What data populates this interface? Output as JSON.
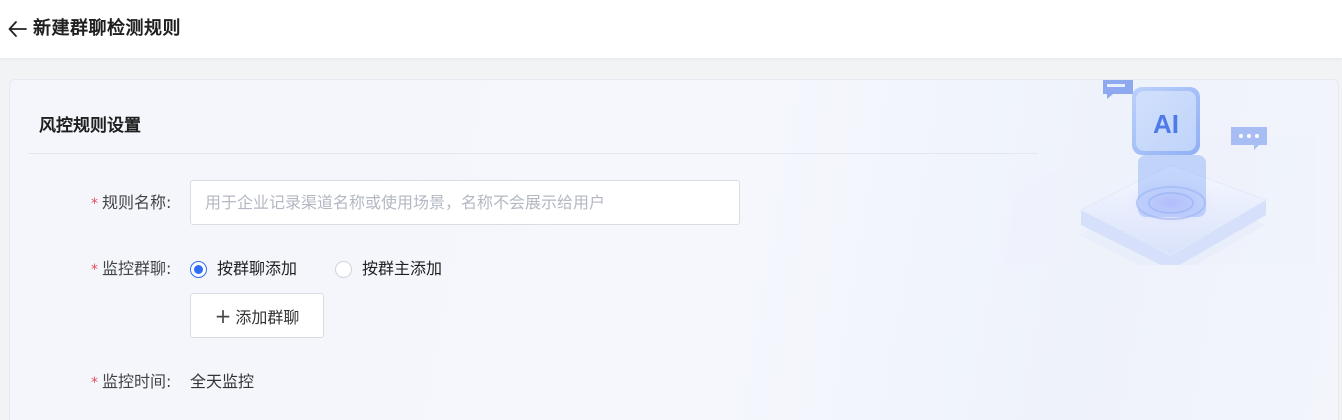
{
  "header": {
    "back_icon": "arrow-left-icon",
    "title": "新建群聊检测规则"
  },
  "section": {
    "title": "风控规则设置",
    "illustration_text": "AI"
  },
  "form": {
    "required_mark": "*",
    "rule_name": {
      "label": "规则名称:",
      "value": "",
      "placeholder": "用于企业记录渠道名称或使用场景，名称不会展示给用户"
    },
    "monitor_group": {
      "label": "监控群聊:",
      "options": [
        {
          "label": "按群聊添加",
          "checked": true
        },
        {
          "label": "按群主添加",
          "checked": false
        }
      ],
      "add_button_icon": "plus-icon",
      "add_button_label": "添加群聊"
    },
    "monitor_time": {
      "label": "监控时间:",
      "value": "全天监控"
    }
  },
  "colors": {
    "accent": "#2f6df6",
    "required": "#e34d59"
  }
}
